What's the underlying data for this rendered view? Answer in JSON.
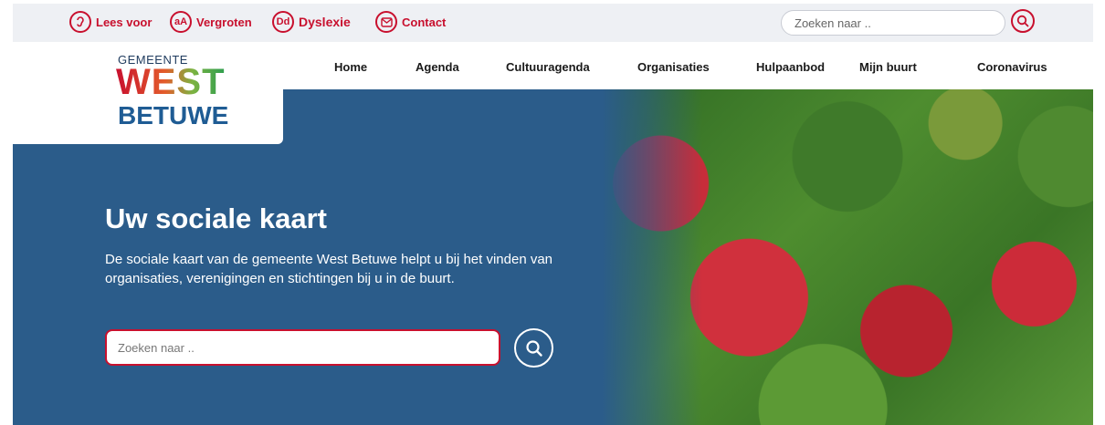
{
  "toolbar": {
    "read_aloud": "Lees voor",
    "enlarge": "Vergroten",
    "enlarge_icon_text": "aA",
    "dyslexia": "Dyslexie",
    "dyslexia_icon_text": "Dd",
    "contact": "Contact"
  },
  "top_search": {
    "placeholder": "Zoeken naar .."
  },
  "logo": {
    "line1": "GEMEENTE",
    "line2": "WEST",
    "line3": "BETUWE"
  },
  "nav": {
    "items": [
      {
        "label": "Home"
      },
      {
        "label": "Agenda"
      },
      {
        "label": "Cultuuragenda"
      },
      {
        "label": "Organisaties"
      },
      {
        "label": "Hulpaanbod"
      },
      {
        "label": "Mijn buurt"
      },
      {
        "label": "Coronavirus"
      }
    ]
  },
  "hero": {
    "title": "Uw sociale kaart",
    "text": "De sociale kaart van de gemeente West Betuwe helpt u bij het vinden van organisaties, verenigingen en stichtingen bij u in de buurt.",
    "search_placeholder": "Zoeken naar .."
  },
  "colors": {
    "accent": "#c8102e",
    "hero_bg": "#2b5c8a",
    "topbar_bg": "#eef0f4"
  }
}
